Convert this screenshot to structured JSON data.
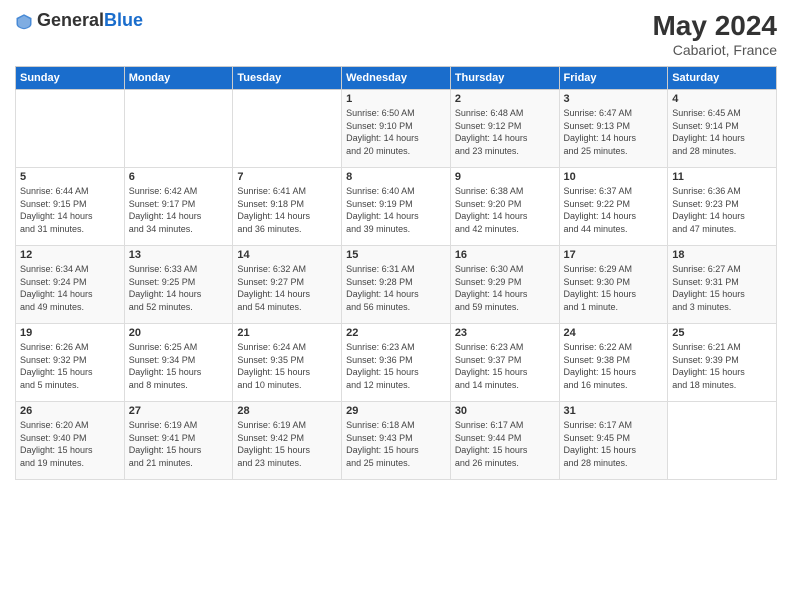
{
  "header": {
    "logo_general": "General",
    "logo_blue": "Blue",
    "month_year": "May 2024",
    "location": "Cabariot, France"
  },
  "days_of_week": [
    "Sunday",
    "Monday",
    "Tuesday",
    "Wednesday",
    "Thursday",
    "Friday",
    "Saturday"
  ],
  "weeks": [
    [
      {
        "day": "",
        "info": ""
      },
      {
        "day": "",
        "info": ""
      },
      {
        "day": "",
        "info": ""
      },
      {
        "day": "1",
        "info": "Sunrise: 6:50 AM\nSunset: 9:10 PM\nDaylight: 14 hours\nand 20 minutes."
      },
      {
        "day": "2",
        "info": "Sunrise: 6:48 AM\nSunset: 9:12 PM\nDaylight: 14 hours\nand 23 minutes."
      },
      {
        "day": "3",
        "info": "Sunrise: 6:47 AM\nSunset: 9:13 PM\nDaylight: 14 hours\nand 25 minutes."
      },
      {
        "day": "4",
        "info": "Sunrise: 6:45 AM\nSunset: 9:14 PM\nDaylight: 14 hours\nand 28 minutes."
      }
    ],
    [
      {
        "day": "5",
        "info": "Sunrise: 6:44 AM\nSunset: 9:15 PM\nDaylight: 14 hours\nand 31 minutes."
      },
      {
        "day": "6",
        "info": "Sunrise: 6:42 AM\nSunset: 9:17 PM\nDaylight: 14 hours\nand 34 minutes."
      },
      {
        "day": "7",
        "info": "Sunrise: 6:41 AM\nSunset: 9:18 PM\nDaylight: 14 hours\nand 36 minutes."
      },
      {
        "day": "8",
        "info": "Sunrise: 6:40 AM\nSunset: 9:19 PM\nDaylight: 14 hours\nand 39 minutes."
      },
      {
        "day": "9",
        "info": "Sunrise: 6:38 AM\nSunset: 9:20 PM\nDaylight: 14 hours\nand 42 minutes."
      },
      {
        "day": "10",
        "info": "Sunrise: 6:37 AM\nSunset: 9:22 PM\nDaylight: 14 hours\nand 44 minutes."
      },
      {
        "day": "11",
        "info": "Sunrise: 6:36 AM\nSunset: 9:23 PM\nDaylight: 14 hours\nand 47 minutes."
      }
    ],
    [
      {
        "day": "12",
        "info": "Sunrise: 6:34 AM\nSunset: 9:24 PM\nDaylight: 14 hours\nand 49 minutes."
      },
      {
        "day": "13",
        "info": "Sunrise: 6:33 AM\nSunset: 9:25 PM\nDaylight: 14 hours\nand 52 minutes."
      },
      {
        "day": "14",
        "info": "Sunrise: 6:32 AM\nSunset: 9:27 PM\nDaylight: 14 hours\nand 54 minutes."
      },
      {
        "day": "15",
        "info": "Sunrise: 6:31 AM\nSunset: 9:28 PM\nDaylight: 14 hours\nand 56 minutes."
      },
      {
        "day": "16",
        "info": "Sunrise: 6:30 AM\nSunset: 9:29 PM\nDaylight: 14 hours\nand 59 minutes."
      },
      {
        "day": "17",
        "info": "Sunrise: 6:29 AM\nSunset: 9:30 PM\nDaylight: 15 hours\nand 1 minute."
      },
      {
        "day": "18",
        "info": "Sunrise: 6:27 AM\nSunset: 9:31 PM\nDaylight: 15 hours\nand 3 minutes."
      }
    ],
    [
      {
        "day": "19",
        "info": "Sunrise: 6:26 AM\nSunset: 9:32 PM\nDaylight: 15 hours\nand 5 minutes."
      },
      {
        "day": "20",
        "info": "Sunrise: 6:25 AM\nSunset: 9:34 PM\nDaylight: 15 hours\nand 8 minutes."
      },
      {
        "day": "21",
        "info": "Sunrise: 6:24 AM\nSunset: 9:35 PM\nDaylight: 15 hours\nand 10 minutes."
      },
      {
        "day": "22",
        "info": "Sunrise: 6:23 AM\nSunset: 9:36 PM\nDaylight: 15 hours\nand 12 minutes."
      },
      {
        "day": "23",
        "info": "Sunrise: 6:23 AM\nSunset: 9:37 PM\nDaylight: 15 hours\nand 14 minutes."
      },
      {
        "day": "24",
        "info": "Sunrise: 6:22 AM\nSunset: 9:38 PM\nDaylight: 15 hours\nand 16 minutes."
      },
      {
        "day": "25",
        "info": "Sunrise: 6:21 AM\nSunset: 9:39 PM\nDaylight: 15 hours\nand 18 minutes."
      }
    ],
    [
      {
        "day": "26",
        "info": "Sunrise: 6:20 AM\nSunset: 9:40 PM\nDaylight: 15 hours\nand 19 minutes."
      },
      {
        "day": "27",
        "info": "Sunrise: 6:19 AM\nSunset: 9:41 PM\nDaylight: 15 hours\nand 21 minutes."
      },
      {
        "day": "28",
        "info": "Sunrise: 6:19 AM\nSunset: 9:42 PM\nDaylight: 15 hours\nand 23 minutes."
      },
      {
        "day": "29",
        "info": "Sunrise: 6:18 AM\nSunset: 9:43 PM\nDaylight: 15 hours\nand 25 minutes."
      },
      {
        "day": "30",
        "info": "Sunrise: 6:17 AM\nSunset: 9:44 PM\nDaylight: 15 hours\nand 26 minutes."
      },
      {
        "day": "31",
        "info": "Sunrise: 6:17 AM\nSunset: 9:45 PM\nDaylight: 15 hours\nand 28 minutes."
      },
      {
        "day": "",
        "info": ""
      }
    ]
  ]
}
